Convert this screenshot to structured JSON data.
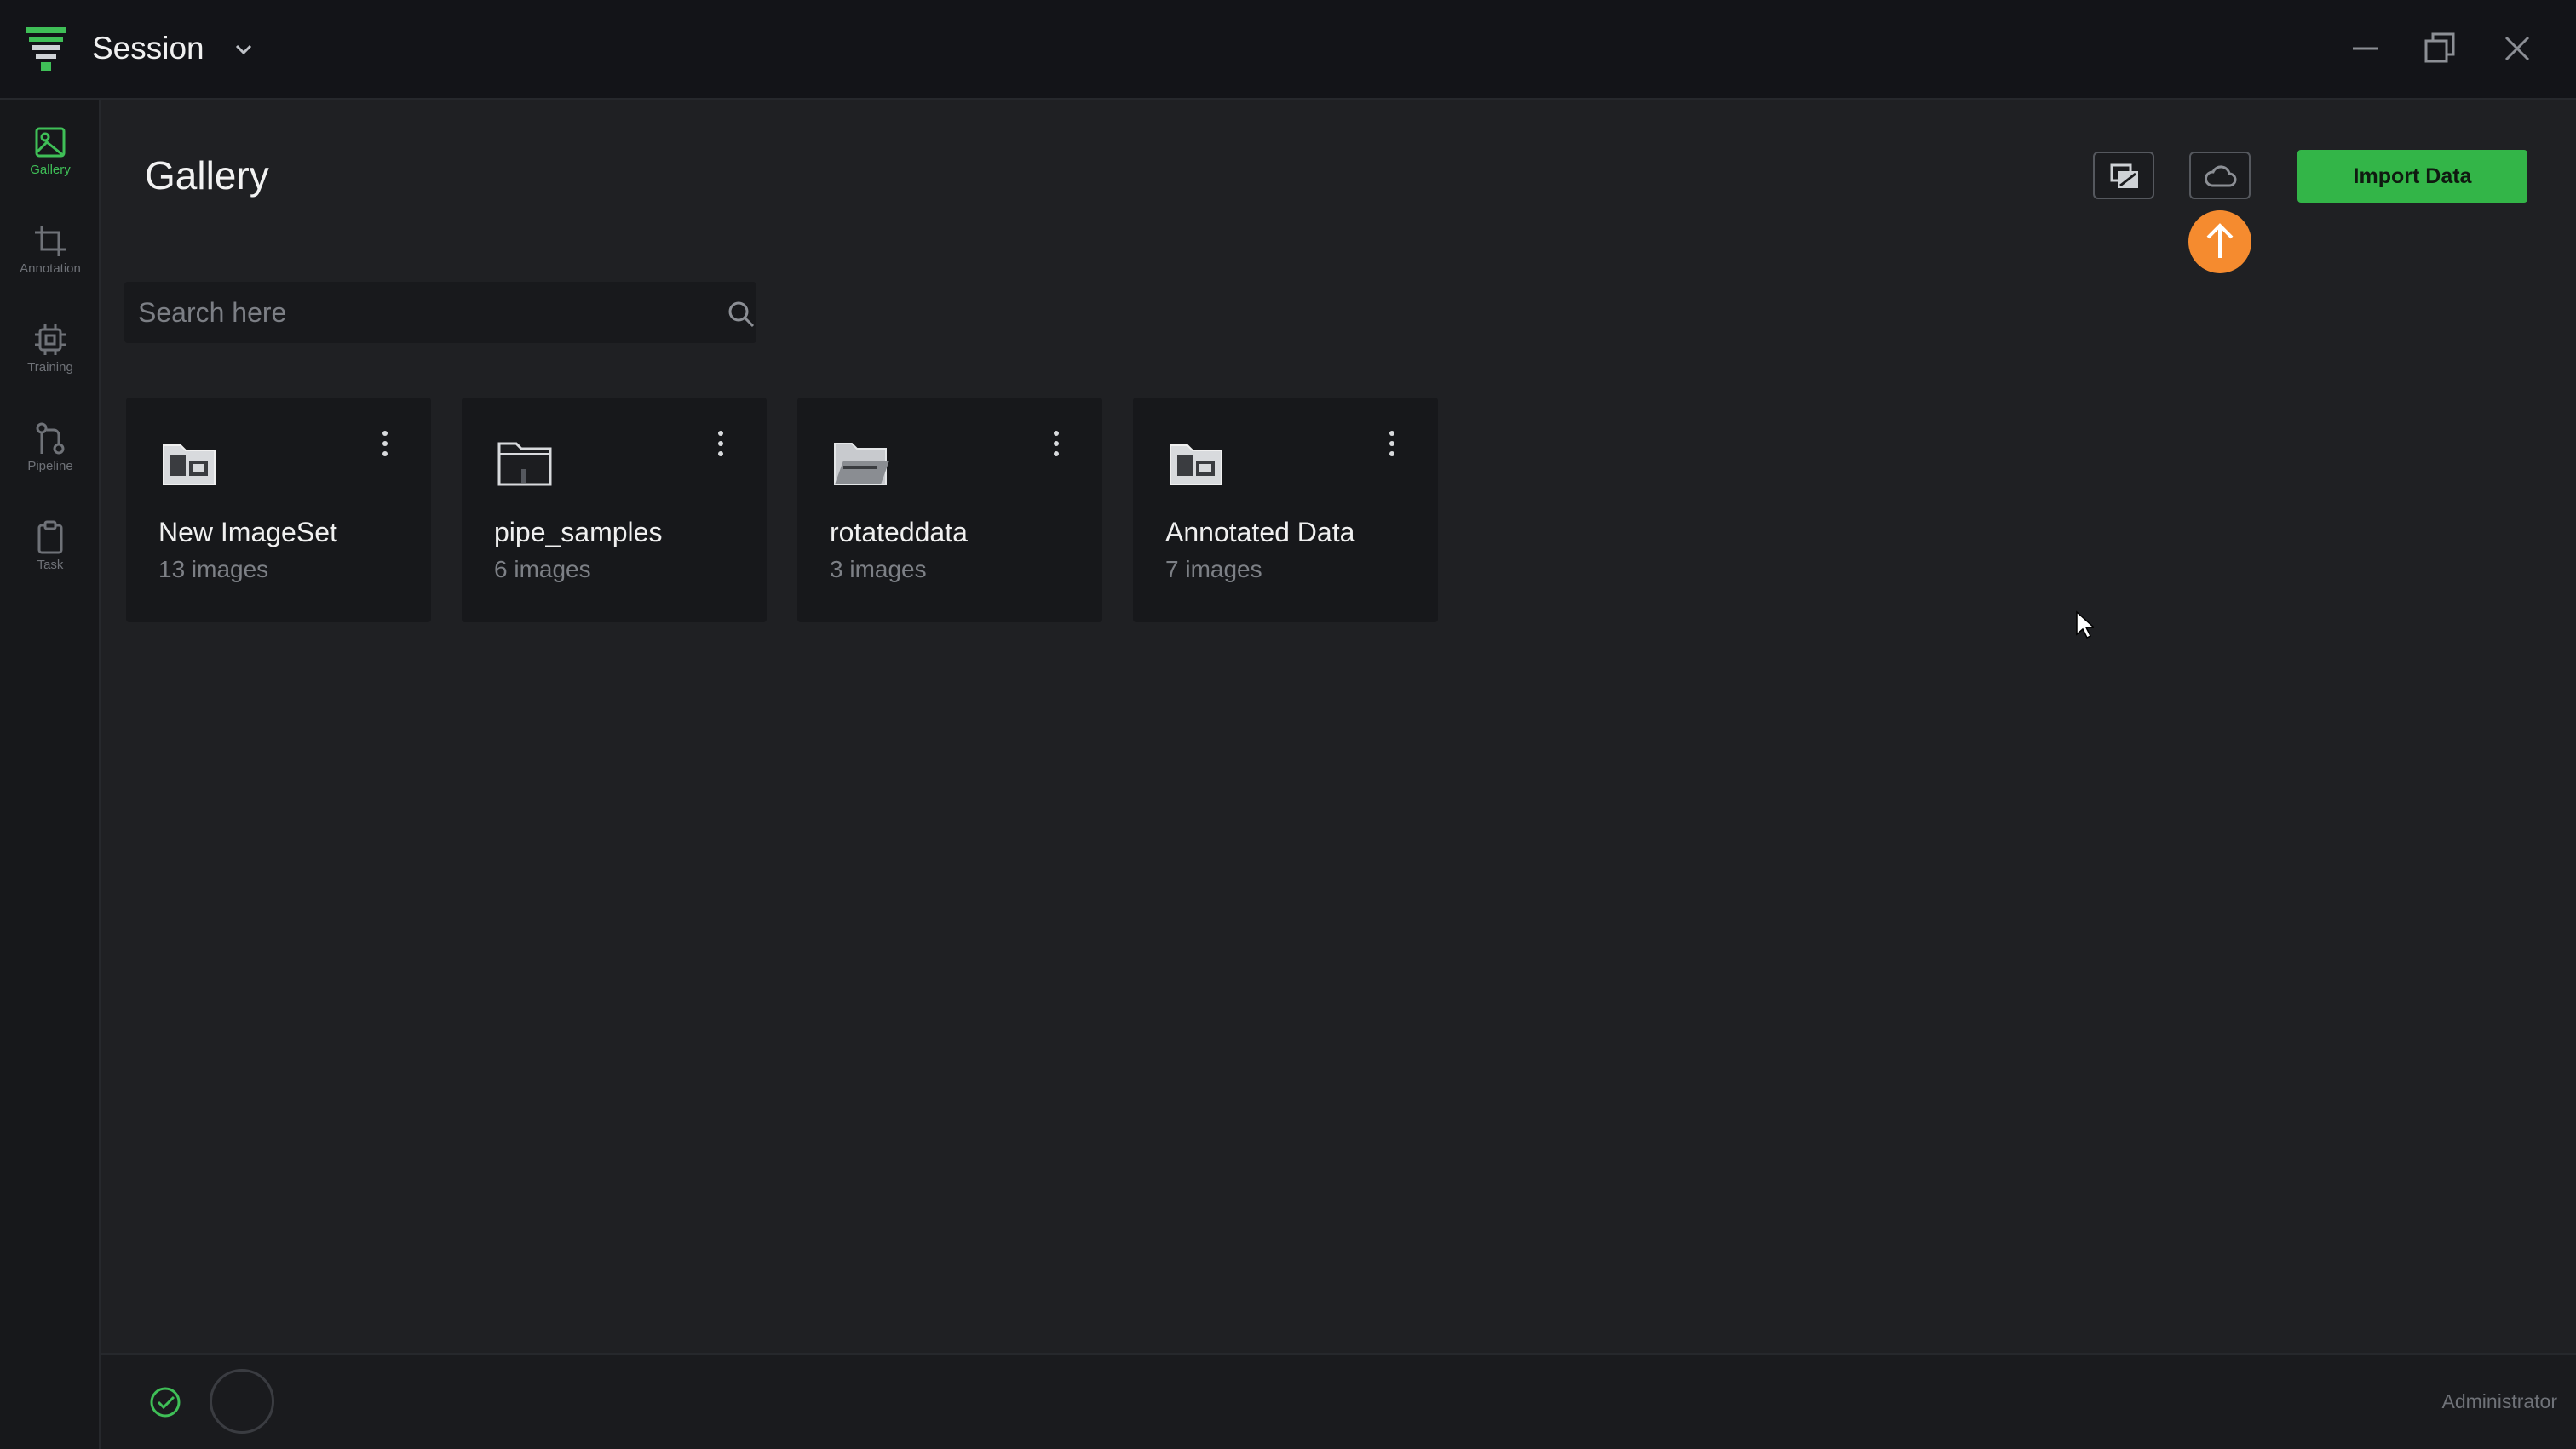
{
  "window": {
    "title": "Session",
    "controls": [
      "minimize-icon",
      "restore-icon",
      "close-icon"
    ]
  },
  "sidebar": {
    "items": [
      {
        "label": "Gallery",
        "icon": "image-icon",
        "active": true
      },
      {
        "label": "Annotation",
        "icon": "crop-icon",
        "active": false
      },
      {
        "label": "Training",
        "icon": "cpu-icon",
        "active": false
      },
      {
        "label": "Pipeline",
        "icon": "pipeline-icon",
        "active": false
      },
      {
        "label": "Task",
        "icon": "clipboard-icon",
        "active": false
      }
    ]
  },
  "main": {
    "title": "Gallery",
    "import_label": "Import Data",
    "search_placeholder": "Search here",
    "cards": [
      {
        "name": "New ImageSet",
        "count": "13 images",
        "icon": "folder-images-icon"
      },
      {
        "name": "pipe_samples",
        "count": "6 images",
        "icon": "folder-empty-icon"
      },
      {
        "name": "rotateddata",
        "count": "3 images",
        "icon": "folder-open-icon"
      },
      {
        "name": "Annotated Data",
        "count": "7 images",
        "icon": "folder-images-icon"
      }
    ]
  },
  "status": {
    "user": "Administrator"
  },
  "colors": {
    "accent": "#33b548",
    "badge": "#f58b2f",
    "background": "#1f2023",
    "sidebar": "#17181b",
    "titlebar": "#131418"
  }
}
